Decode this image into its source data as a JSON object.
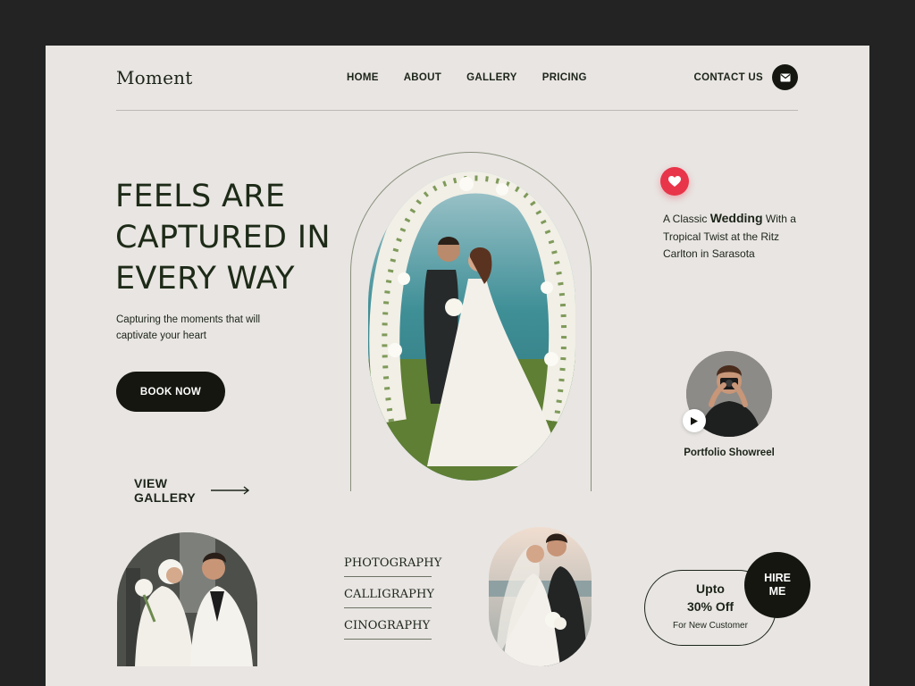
{
  "brand": {
    "logo": "Moment"
  },
  "nav": {
    "items": [
      {
        "label": "HOME"
      },
      {
        "label": "ABOUT"
      },
      {
        "label": "GALLERY"
      },
      {
        "label": "PRICING"
      }
    ],
    "contact_label": "CONTACT US",
    "contact_icon": "mail-icon"
  },
  "hero": {
    "title": "FEELS ARE CAPTURED IN EVERY WAY",
    "subtitle": "Capturing the moments that will captivate your heart",
    "cta_label": "BOOK NOW",
    "view_gallery_label": "VIEW GALLERY",
    "view_gallery_icon": "arrow-right-icon"
  },
  "feature": {
    "badge_icon": "heart-icon",
    "badge_color": "#e8354a",
    "text_before": "A Classic ",
    "text_highlight": "Wedding",
    "text_after": " With a Tropical Twist at the Ritz Carlton in Sarasota"
  },
  "showreel": {
    "label": "Portfolio Showreel",
    "play_icon": "play-icon"
  },
  "services": [
    {
      "label": "PHOTOGRAPHY"
    },
    {
      "label": "CALLIGRAPHY"
    },
    {
      "label": "CINOGRAPHY"
    }
  ],
  "offer": {
    "line1": "Upto",
    "line2": "30% Off",
    "line3": "For New Customer"
  },
  "hire": {
    "label": "HIRE ME"
  },
  "colors": {
    "page_bg": "#e8e5e2",
    "frame_bg": "#232323",
    "dark": "#14160f",
    "text": "#1c2418",
    "accent": "#e8354a"
  }
}
